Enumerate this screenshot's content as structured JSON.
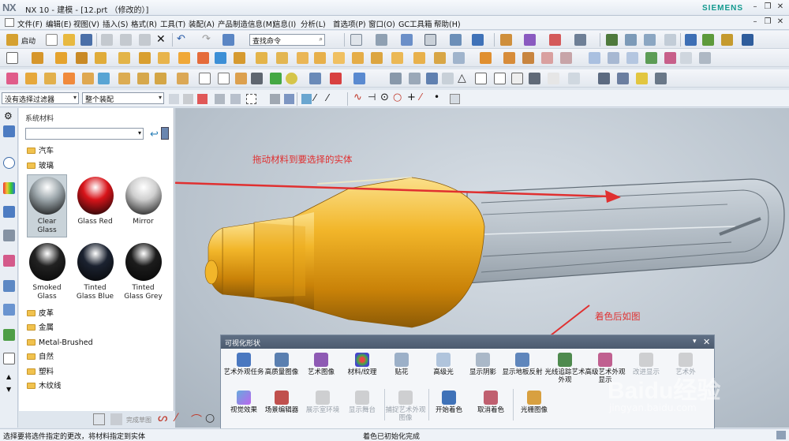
{
  "app": {
    "logo": "NX",
    "title": "NX 10 - 建模 - [12.prt （修改的）]",
    "brand": "SIEMENS",
    "win_min": "–",
    "win_restore": "❐",
    "win_close": "✕",
    "win2_min": "–",
    "win2_restore": "❐",
    "win2_close": "✕"
  },
  "menubar": {
    "items": [
      "文件(F)",
      "编辑(E)",
      "视图(V)",
      "插入(S)",
      "格式(R)",
      "工具(T)",
      "装配(A)",
      "产品制造信息(M)",
      "信息(I)",
      "分析(L)",
      "首选项(P)",
      "窗口(O)",
      "GC工具箱",
      "帮助(H)"
    ],
    "start_label": "启动",
    "search_placeholder": "查找命令"
  },
  "filterbar": {
    "selection_filter": "没有选择过滤器",
    "assembly_scope": "整个装配"
  },
  "material_panel": {
    "title": "系统材料",
    "folders_top": [
      "汽车",
      "玻璃"
    ],
    "swatches": [
      {
        "label": "Clear Glass",
        "color": "#9ea8ad"
      },
      {
        "label": "Glass Red",
        "color": "#d8141a"
      },
      {
        "label": "Mirror",
        "color": "#cfcfcf"
      },
      {
        "label": "Smoked Glass",
        "color": "#222222"
      },
      {
        "label": "Tinted Glass Blue",
        "color": "#1b2230"
      },
      {
        "label": "Tinted Glass Grey",
        "color": "#1c1c1c"
      }
    ],
    "folders_bottom": [
      "皮革",
      "金属",
      "Metal-Brushed",
      "自然",
      "塑料",
      "木纹线"
    ]
  },
  "annotations": {
    "drag_hint": "拖动材料到要选择的实体",
    "after_hint": "着色后如图"
  },
  "dialog": {
    "title": "可视化形状",
    "collapse": "▾",
    "close": "✕",
    "row1": [
      {
        "label": "艺术外观任务",
        "disabled": false
      },
      {
        "label": "高质量图像",
        "disabled": false
      },
      {
        "label": "艺术图像",
        "disabled": false
      },
      {
        "label": "材料/纹理",
        "disabled": false
      },
      {
        "label": "贴花",
        "disabled": false
      },
      {
        "label": "高级光",
        "disabled": false
      },
      {
        "label": "显示阴影",
        "disabled": false
      },
      {
        "label": "显示地板反射",
        "disabled": false
      },
      {
        "label": "光线追踪艺术外观",
        "disabled": false
      },
      {
        "label": "高级艺术外观显示",
        "disabled": false
      },
      {
        "label": "改进显示",
        "disabled": true
      },
      {
        "label": "艺术外",
        "disabled": true
      }
    ],
    "row2": [
      {
        "label": "视觉效果",
        "disabled": false
      },
      {
        "label": "场景编辑器",
        "disabled": false
      },
      {
        "label": "展示室环境",
        "disabled": true
      },
      {
        "label": "显示舞台",
        "disabled": true
      },
      {
        "label": "捕捉艺术外观图像",
        "disabled": true
      },
      {
        "label": "开始着色",
        "disabled": false
      },
      {
        "label": "取消着色",
        "disabled": false
      },
      {
        "label": "光栅图像",
        "disabled": false
      }
    ]
  },
  "bottom_toolbar": {
    "label": "完成草图"
  },
  "status": {
    "left": "选择要将选件指定的更改，将材料指定到实体",
    "middle": "着色已初始化完成"
  },
  "watermark": {
    "logo": "Baidu经验",
    "url": "jingyan.baidu.com"
  },
  "colors": {
    "accent": "#11998e",
    "annotation": "#e03030",
    "gold": "#e8a61a"
  }
}
